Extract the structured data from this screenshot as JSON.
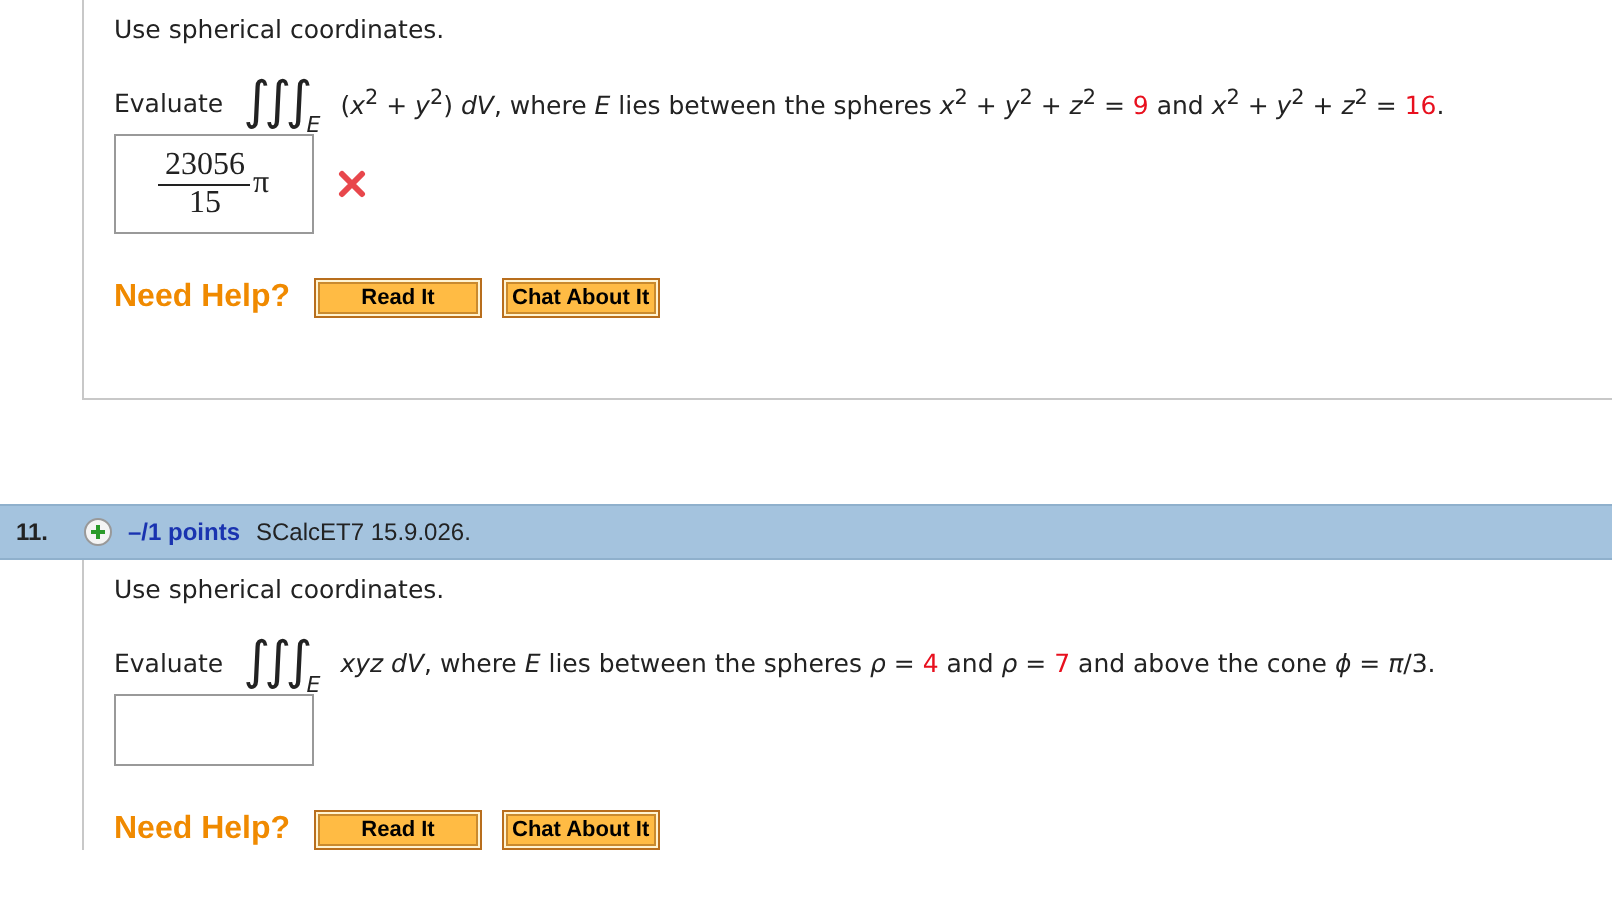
{
  "problems": [
    {
      "instruction": "Use spherical coordinates.",
      "prompt": "Evaluate",
      "integral": {
        "sign": "∫∫∫",
        "domain": "E"
      },
      "statement": [
        {
          "kind": "text",
          "text": "(*x*$^{2}$ + *y*$^{2}$) *dV*,  where *E* lies between the spheres  *x*$^{2}$ + *y*$^{2}$ + *z*$^{2}$ = "
        },
        {
          "kind": "given",
          "text": "9"
        },
        {
          "kind": "text",
          "text": " and *x*$^{2}$ + *y*$^{2}$ + *z*$^{2}$ = "
        },
        {
          "kind": "given",
          "text": "16"
        },
        {
          "kind": "text",
          "text": "."
        }
      ],
      "answer": {
        "numerator": "23056",
        "denominator": "15",
        "factor": "π"
      },
      "incorrect": true,
      "help": {
        "label": "Need Help?",
        "buttons": [
          "Read It",
          "Chat About It"
        ]
      }
    },
    {
      "header": {
        "number": "11.",
        "points": "–/1 points",
        "code": "SCalcET7 15.9.026."
      },
      "instruction": "Use spherical coordinates.",
      "prompt": "Evaluate",
      "integral": {
        "sign": "∫∫∫",
        "domain": "E"
      },
      "statement": [
        {
          "kind": "text",
          "text": "*xyz dV*,  where *E* lies between the spheres *ρ* = "
        },
        {
          "kind": "given",
          "text": "4"
        },
        {
          "kind": "text",
          "text": " and *ρ* = "
        },
        {
          "kind": "given",
          "text": "7"
        },
        {
          "kind": "text",
          "text": " and above the cone *ϕ* = *π*/3."
        }
      ],
      "help": {
        "label": "Need Help?",
        "buttons": [
          "Read It",
          "Chat About It"
        ]
      }
    }
  ]
}
